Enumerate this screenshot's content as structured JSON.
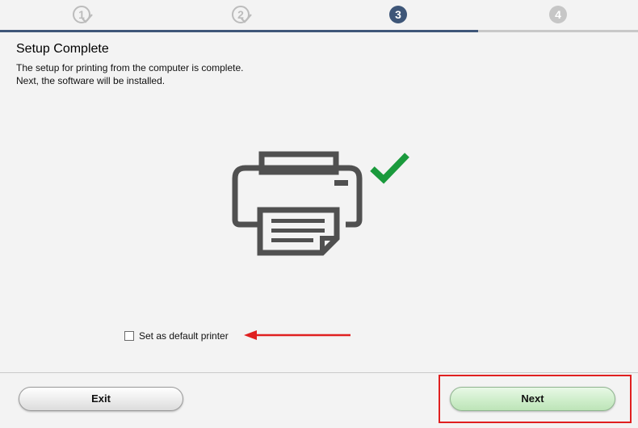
{
  "stepper": {
    "steps": [
      {
        "number": "1",
        "state": "done"
      },
      {
        "number": "2",
        "state": "done"
      },
      {
        "number": "3",
        "state": "current"
      },
      {
        "number": "4",
        "state": "future"
      }
    ]
  },
  "main": {
    "title": "Setup Complete",
    "description_line1": "The setup for printing from the computer is complete.",
    "description_line2": "Next, the software will be installed.",
    "illustration_icon": "printer-icon",
    "status_icon": "checkmark-icon",
    "default_printer_label": "Set as default printer",
    "default_printer_checked": false
  },
  "footer": {
    "exit_label": "Exit",
    "next_label": "Next"
  },
  "colors": {
    "step_active": "#3e5678",
    "step_inactive": "#c6c6c6",
    "check_green": "#1a9a3c",
    "printer_gray": "#505050",
    "annotation_red": "#e02020",
    "next_button_green": "#cfeecb"
  }
}
